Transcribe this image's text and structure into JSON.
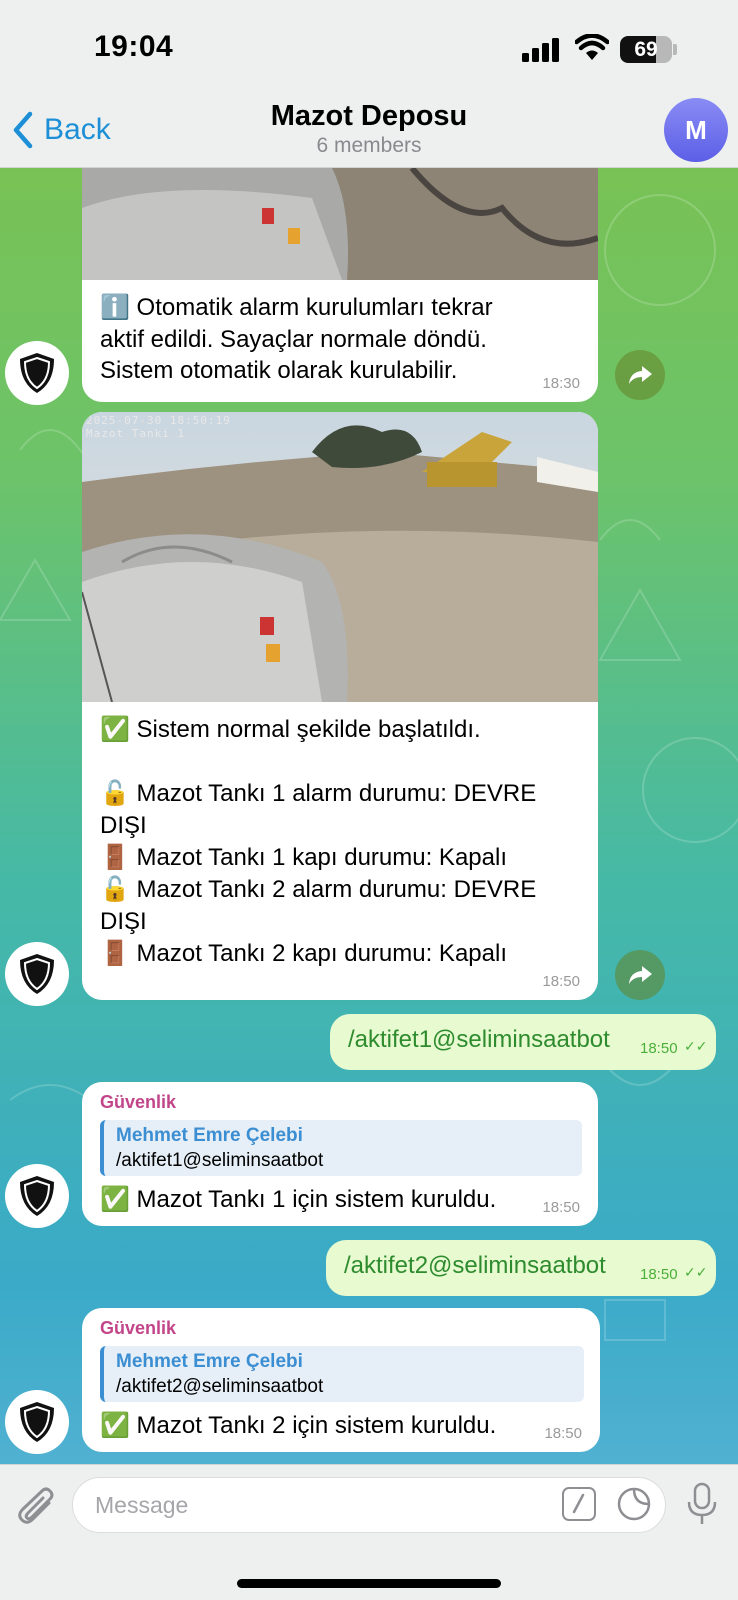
{
  "status_bar": {
    "time": "19:04",
    "battery": "69",
    "battery_level": 0.69
  },
  "header": {
    "back_label": "Back",
    "title": "Mazot Deposu",
    "subtitle": "6 members",
    "avatar_letter": "M"
  },
  "messages": [
    {
      "type": "incoming-photo",
      "text": "ℹ️ Otomatik alarm kurulumları tekrar\naktif edildi. Sayaçlar normale döndü.\nSistem otomatik olarak kurulabilir.",
      "time": "18:30"
    },
    {
      "type": "incoming-photo",
      "camera_stamp": "2025-07-30 18:50:19",
      "camera_name": "Mazot Tanki 1",
      "text": "✅ Sistem normal şekilde başlatıldı.\n\n🔓 Mazot Tankı 1 alarm durumu: DEVRE\nDIŞI\n🚪 Mazot Tankı 1 kapı durumu: Kapalı\n🔓 Mazot Tankı 2 alarm durumu: DEVRE\nDIŞI\n🚪 Mazot Tankı 2 kapı durumu: Kapalı",
      "time": "18:50"
    },
    {
      "type": "outgoing",
      "text": "/aktifet1@seliminsaatbot",
      "time": "18:50"
    },
    {
      "type": "incoming-reply",
      "sender": "Güvenlik",
      "reply_name": "Mehmet Emre Çelebi",
      "reply_text": "/aktifet1@seliminsaatbot",
      "text": "✅ Mazot Tankı 1 için sistem kuruldu.",
      "time": "18:50"
    },
    {
      "type": "outgoing",
      "text": "/aktifet2@seliminsaatbot",
      "time": "18:50"
    },
    {
      "type": "incoming-reply",
      "sender": "Güvenlik",
      "reply_name": "Mehmet Emre Çelebi",
      "reply_text": "/aktifet2@seliminsaatbot",
      "text": "✅ Mazot Tankı 2 için sistem kuruldu.",
      "time": "18:50"
    }
  ],
  "input": {
    "placeholder": "Message"
  },
  "icons": {
    "back": "chevron-left-icon",
    "attach": "paperclip-icon",
    "commands": "slash-command-icon",
    "sticker": "sticker-icon",
    "mic": "microphone-icon",
    "share": "forward-icon",
    "bot": "shield-icon"
  },
  "colors": {
    "accent": "#1d8fd6",
    "sender": "#c2458a",
    "outgoing_bubble": "#e7fad0",
    "reply_accent": "#3c8ed2"
  }
}
